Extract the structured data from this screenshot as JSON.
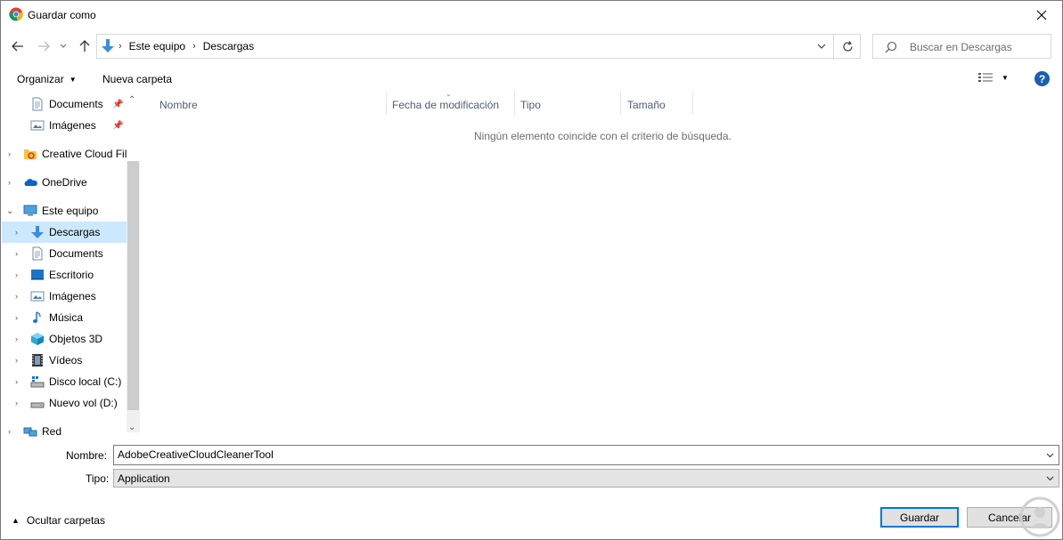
{
  "window": {
    "title": "Guardar como"
  },
  "address": {
    "crumbs": [
      "Este equipo",
      "Descargas"
    ]
  },
  "search": {
    "placeholder": "Buscar en Descargas"
  },
  "toolbar": {
    "organize_label": "Organizar",
    "new_folder_label": "Nueva carpeta"
  },
  "nav": {
    "quick_access": [
      {
        "label": "Documents",
        "icon": "document-icon",
        "pinned": true
      },
      {
        "label": "Imágenes",
        "icon": "pictures-icon",
        "pinned": true
      }
    ],
    "roots": [
      {
        "label": "Creative Cloud Fil",
        "icon": "creative-cloud-icon"
      },
      {
        "label": "OneDrive",
        "icon": "onedrive-icon"
      },
      {
        "label": "Este equipo",
        "icon": "computer-icon",
        "expanded": true
      }
    ],
    "this_pc_children": [
      {
        "label": "Descargas",
        "icon": "downloads-icon",
        "selected": true
      },
      {
        "label": "Documents",
        "icon": "document-icon"
      },
      {
        "label": "Escritorio",
        "icon": "desktop-icon"
      },
      {
        "label": "Imágenes",
        "icon": "pictures-icon"
      },
      {
        "label": "Música",
        "icon": "music-icon"
      },
      {
        "label": "Objetos 3D",
        "icon": "3d-objects-icon"
      },
      {
        "label": "Vídeos",
        "icon": "videos-icon"
      },
      {
        "label": "Disco local (C:)",
        "icon": "drive-icon"
      },
      {
        "label": "Nuevo vol (D:)",
        "icon": "drive-icon"
      }
    ],
    "network": {
      "label": "Red",
      "icon": "network-icon"
    }
  },
  "columns": [
    "Nombre",
    "Fecha de modificación",
    "Tipo",
    "Tamaño"
  ],
  "empty_message": "Ningún elemento coincide con el criterio de búsqueda.",
  "form": {
    "name_label": "Nombre:",
    "name_value": "AdobeCreativeCloudCleanerTool",
    "type_label": "Tipo:",
    "type_value": "Application"
  },
  "footer": {
    "hide_folders_label": "Ocultar carpetas",
    "save_label": "Guardar",
    "cancel_label": "Cancelar"
  },
  "colors": {
    "accent": "#0078d7",
    "selection": "#cce8ff",
    "header_text": "#4c607a"
  }
}
